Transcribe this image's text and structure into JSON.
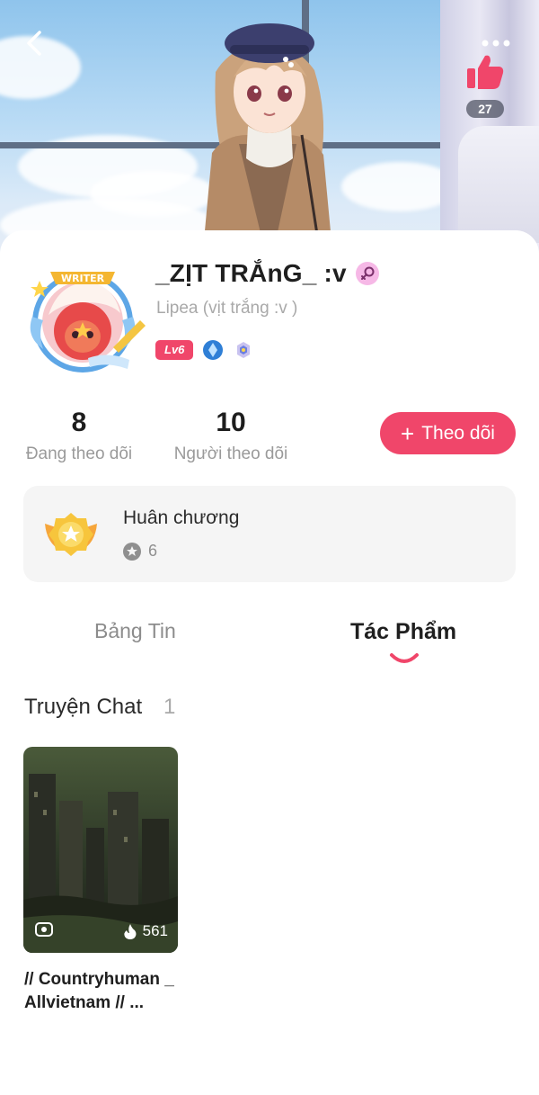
{
  "header": {
    "back_icon": "chevron-left-icon",
    "more_icon": "more-dots-icon",
    "like_icon": "thumbs-up-icon",
    "like_count": "27"
  },
  "profile": {
    "username": "_ZỊT TRẮnG_ :v",
    "gender_icon": "female-symbol-icon",
    "display_name": "Lipea (vịt trắng :v )",
    "avatar_frame_label": "WRITER",
    "level": "Lv6",
    "badge_icons": [
      "blue-diamond-badge-icon",
      "hexagon-badge-icon"
    ]
  },
  "stats": {
    "following_count": "8",
    "following_label": "Đang theo dõi",
    "followers_count": "10",
    "followers_label": "Người theo dõi"
  },
  "follow_button": {
    "plus": "+",
    "label": "Theo dõi"
  },
  "medals": {
    "title": "Huân chương",
    "count": "6",
    "icon": "gold-medal-icon"
  },
  "tabs": [
    {
      "label": "Bảng Tin",
      "active": false
    },
    {
      "label": "Tác Phẩm",
      "active": true
    }
  ],
  "section": {
    "title": "Truyện Chat",
    "count": "1"
  },
  "stories": [
    {
      "title": "// Countryhuman _ Allvietnam // ...",
      "views": "561",
      "type_icon": "chat-camera-icon",
      "views_icon": "flame-icon"
    }
  ],
  "colors": {
    "accent": "#f0466a",
    "card_bg": "#f5f5f5",
    "muted_text": "#9a9a9a"
  }
}
